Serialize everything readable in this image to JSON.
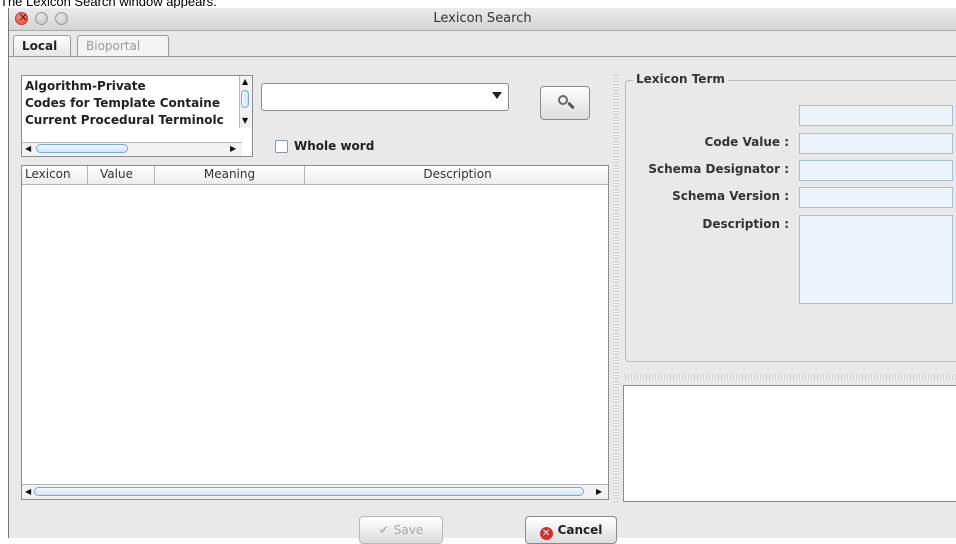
{
  "caption": "The Lexicon Search window appears.",
  "window": {
    "title": "Lexicon Search"
  },
  "tabs": [
    {
      "label": "Local",
      "active": true
    },
    {
      "label": "Bioportal",
      "active": false
    }
  ],
  "lexicons": [
    "Algorithm-Private",
    "Codes for Template Containe",
    "Current Procedural Terminolc"
  ],
  "search": {
    "value": "",
    "whole_word_label": "Whole word",
    "whole_word_checked": false
  },
  "table": {
    "columns": [
      "Lexicon",
      "Value",
      "Meaning",
      "Description"
    ],
    "rows": []
  },
  "lexicon_term": {
    "legend": "Lexicon Term",
    "code_value_label": "Code Value :",
    "schema_designator_label": "Schema Designator :",
    "schema_version_label": "Schema Version :",
    "description_label": "Description :",
    "code_value": "",
    "schema_designator": "",
    "schema_version": "",
    "description": ""
  },
  "buttons": {
    "save": "Save",
    "cancel": "Cancel"
  },
  "icons": {
    "search": "magnifier-icon",
    "save": "checkmark-icon",
    "cancel": "cancel-icon"
  },
  "colors": {
    "accent": "#7ba8d9",
    "field_bg": "#edf3fa",
    "cancel_red": "#d62f2f"
  }
}
